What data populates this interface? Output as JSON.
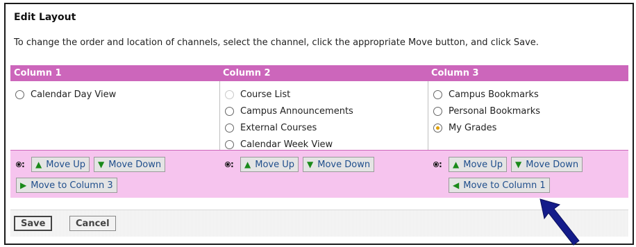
{
  "title": "Edit Layout",
  "instructions": "To change the order and location of channels, select the channel, click the appropriate Move button, and click Save.",
  "columns": [
    {
      "header": "Column 1",
      "channels": [
        {
          "label": "Calendar Day View",
          "state": "unchecked"
        }
      ],
      "buttons": {
        "move_up": "Move Up",
        "move_down": "Move Down",
        "move_to": "Move to Column 3"
      }
    },
    {
      "header": "Column 2",
      "channels": [
        {
          "label": "Course List",
          "state": "disabled"
        },
        {
          "label": "Campus Announcements",
          "state": "unchecked"
        },
        {
          "label": "External Courses",
          "state": "unchecked"
        },
        {
          "label": "Calendar Week View",
          "state": "unchecked"
        }
      ],
      "buttons": {
        "move_up": "Move Up",
        "move_down": "Move Down"
      }
    },
    {
      "header": "Column 3",
      "channels": [
        {
          "label": "Campus Bookmarks",
          "state": "unchecked"
        },
        {
          "label": "Personal Bookmarks",
          "state": "unchecked"
        },
        {
          "label": "My Grades",
          "state": "checked"
        }
      ],
      "buttons": {
        "move_up": "Move Up",
        "move_down": "Move Down",
        "move_to": "Move to Column 1"
      }
    }
  ],
  "footer": {
    "save_label": "Save",
    "cancel_label": "Cancel"
  },
  "colors": {
    "header_bg": "#cc66bb",
    "button_row_bg": "#f6c4ee",
    "arrow_color": "#1a8a1a",
    "pointer_color": "#141c8a"
  }
}
